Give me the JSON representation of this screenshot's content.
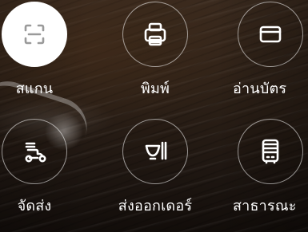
{
  "menu": {
    "items": [
      {
        "id": "scan",
        "label": "สแกน",
        "icon": "scan-icon",
        "active": true
      },
      {
        "id": "print",
        "label": "พิมพ์",
        "icon": "printer-icon",
        "active": false
      },
      {
        "id": "read_card",
        "label": "อ่านบัตร",
        "icon": "card-icon",
        "active": false
      },
      {
        "id": "delivery",
        "label": "จัดส่ง",
        "icon": "scooter-icon",
        "active": false
      },
      {
        "id": "order_out",
        "label": "ส่งออกเดอร์",
        "icon": "bowl-icon",
        "active": false
      },
      {
        "id": "public",
        "label": "สาธารณะ",
        "icon": "bus-icon",
        "active": false
      }
    ]
  },
  "colors": {
    "icon_active": "#ffffff",
    "icon_default": "#ffffff",
    "active_bg": "#ffffff",
    "active_icon_stroke": "#9a9a9a"
  }
}
